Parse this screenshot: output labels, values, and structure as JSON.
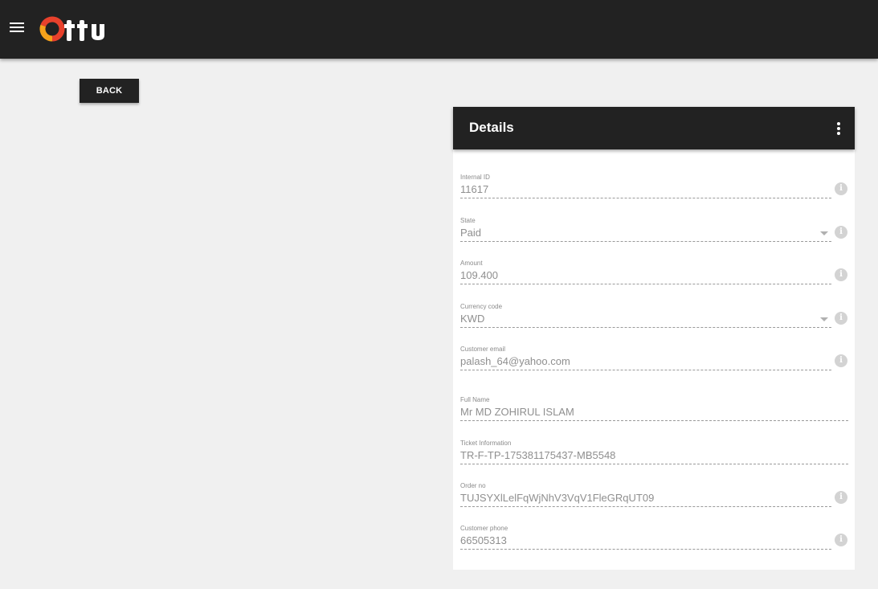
{
  "header": {
    "menu_icon": "hamburger-menu-icon",
    "logo": {
      "text": "Ottu",
      "accent": "#e8412c",
      "accent2": "#f7a21b"
    }
  },
  "back_button": {
    "label": "BACK"
  },
  "details": {
    "title": "Details",
    "fields": [
      {
        "label": "Internal ID",
        "value": "11617"
      },
      {
        "label": "State",
        "value": "Paid"
      },
      {
        "label": "Amount",
        "value": "109.400"
      },
      {
        "label": "Currency code",
        "value": "KWD"
      },
      {
        "label": "Customer email",
        "value": "palash_64@yahoo.com"
      },
      {
        "label": "Full Name",
        "value": "Mr MD ZOHIRUL ISLAM"
      },
      {
        "label": "Ticket Information",
        "value": "TR-F-TP-175381175437-MB5548"
      },
      {
        "label": "Order no",
        "value": "TUJSYXlLelFqWjNhV3VqV1FleGRqUT09"
      },
      {
        "label": "Customer phone",
        "value": "66505313"
      }
    ]
  },
  "colors": {
    "dark": "#222222",
    "background": "#f0f0f0",
    "info_icon": "#d3d3d3"
  }
}
